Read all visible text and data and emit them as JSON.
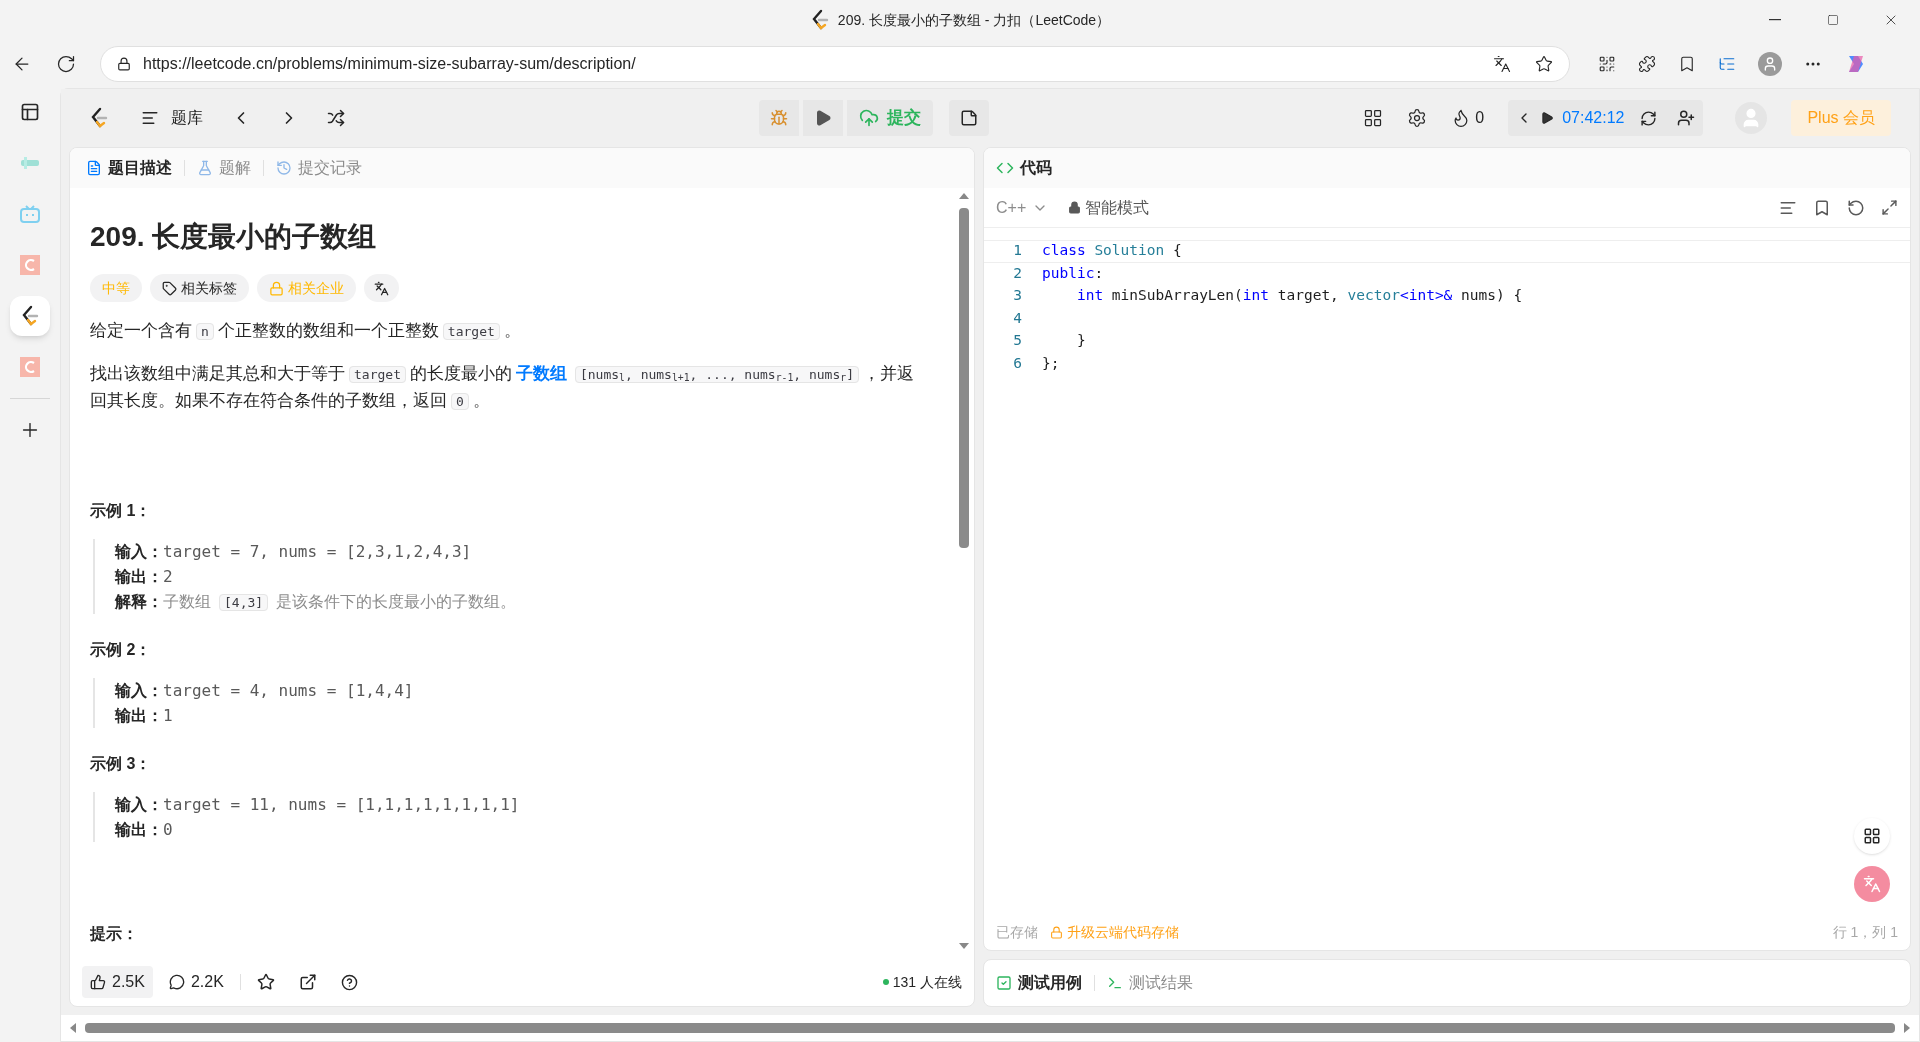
{
  "browser": {
    "title": "209. 长度最小的子数组 - 力扣（LeetCode）",
    "url": "https://leetcode.cn/problems/minimum-size-subarray-sum/description/"
  },
  "browser_sidebar": [
    {
      "kind": "tabs",
      "selected": false
    },
    {
      "kind": "audio",
      "selected": false
    },
    {
      "kind": "tv",
      "selected": false
    },
    {
      "kind": "c",
      "selected": false
    },
    {
      "kind": "leetcode",
      "selected": true
    },
    {
      "kind": "c",
      "selected": false
    },
    {
      "kind": "add",
      "selected": false
    }
  ],
  "header": {
    "bank": "题库",
    "submit": "提交",
    "streak": "0",
    "timer": "07:42:12",
    "plus": "Plus 会员"
  },
  "left_tabs": [
    {
      "label": "题目描述",
      "kind": "doc",
      "selected": true
    },
    {
      "label": "题解",
      "kind": "flask",
      "selected": false
    },
    {
      "label": "提交记录",
      "kind": "history",
      "selected": false
    }
  ],
  "problem": {
    "title": "209. 长度最小的子数组",
    "tags": [
      {
        "label": "中等",
        "kind": "difficulty"
      },
      {
        "label": "相关标签",
        "kind": "tag"
      },
      {
        "label": "相关企业",
        "kind": "locked"
      },
      {
        "kind": "translate"
      }
    ],
    "paragraphs": [
      [
        {
          "kind": "text",
          "text": "给定一个含有"
        },
        {
          "kind": "code",
          "text": "n"
        },
        {
          "kind": "text",
          "text": "个正整数的数组和一个正整数"
        },
        {
          "kind": "code",
          "text": "target"
        },
        {
          "kind": "text",
          "text": "。"
        }
      ],
      [
        {
          "kind": "text",
          "text": "找出该数组中满足其总和大于等于"
        },
        {
          "kind": "code",
          "text": "target"
        },
        {
          "kind": "text",
          "text": "的长度最小的"
        },
        {
          "kind": "link",
          "text": "子数组"
        },
        {
          "kind": "code",
          "text": "[nums$_{l}$, nums$_{l+1}$, ..., nums$_{r-1}$, nums$_{r}$]"
        },
        {
          "kind": "text",
          "text": "，并返回其长度。如果不存在符合条件的子数组，返回"
        },
        {
          "kind": "code",
          "text": "0"
        },
        {
          "kind": "text",
          "text": "。"
        }
      ]
    ],
    "examples": [
      {
        "title": "示例 1：",
        "lines": [
          {
            "label": "输入：",
            "value": "target = 7, nums = [2,3,1,2,4,3]"
          },
          {
            "label": "输出：",
            "value": "2"
          },
          {
            "label": "解释：",
            "segments": [
              {
                "kind": "text",
                "text": "子数组"
              },
              {
                "kind": "code",
                "text": "[4,3]"
              },
              {
                "kind": "text",
                "text": "是该条件下的长度最小的子数组。"
              }
            ]
          }
        ]
      },
      {
        "title": "示例 2：",
        "lines": [
          {
            "label": "输入：",
            "value": "target = 4, nums = [1,4,4]"
          },
          {
            "label": "输出：",
            "value": "1"
          }
        ]
      },
      {
        "title": "示例 3：",
        "lines": [
          {
            "label": "输入：",
            "value": "target = 11, nums = [1,1,1,1,1,1,1,1]"
          },
          {
            "label": "输出：",
            "value": "0"
          }
        ]
      }
    ],
    "hint_heading": "提示："
  },
  "left_footer": {
    "likes": "2.5K",
    "comments": "2.2K",
    "online": "131 人在线"
  },
  "code_panel": {
    "title": "代码",
    "language": "C++",
    "mode": "智能模式",
    "lines": [
      {
        "number": "1",
        "tokens": [
          {
            "kind": "keyword",
            "text": "class"
          },
          {
            "kind": "type",
            "text": " Solution"
          },
          {
            "kind": "plain",
            "text": " {"
          }
        ]
      },
      {
        "number": "2",
        "tokens": [
          {
            "kind": "keyword",
            "text": "public"
          },
          {
            "kind": "plain",
            "text": ":"
          }
        ]
      },
      {
        "number": "3",
        "tokens": [
          {
            "kind": "keyword",
            "text": "    int"
          },
          {
            "kind": "plain",
            "text": " minSubArrayLen("
          },
          {
            "kind": "keyword",
            "text": "int"
          },
          {
            "kind": "plain",
            "text": " target, "
          },
          {
            "kind": "type",
            "text": "vector"
          },
          {
            "kind": "keyword",
            "text": "<int>&"
          },
          {
            "kind": "plain",
            "text": " nums) {"
          }
        ]
      },
      {
        "number": "4"
      },
      {
        "number": "5",
        "tokens": [
          {
            "kind": "plain",
            "text": "    }"
          }
        ]
      },
      {
        "number": "6",
        "tokens": [
          {
            "kind": "plain",
            "text": "};"
          }
        ]
      }
    ],
    "saved": "已存储",
    "upgrade": "升级云端代码存储",
    "position": "行 1，列 1"
  },
  "bottom_tabs": [
    {
      "label": "测试用例",
      "kind": "check",
      "selected": true
    },
    {
      "label": "测试结果",
      "kind": "terminal",
      "selected": false
    }
  ]
}
